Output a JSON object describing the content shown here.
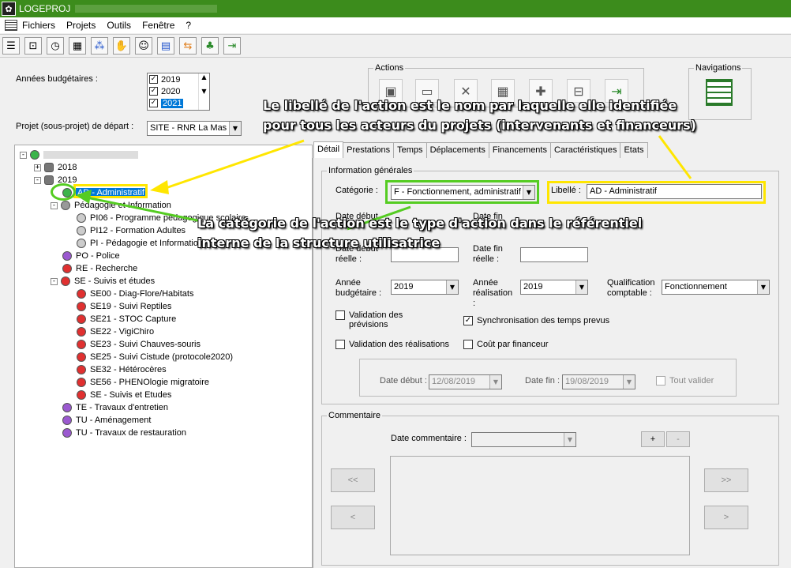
{
  "window": {
    "title": "LOGEPROJ"
  },
  "menu": [
    "Fichiers",
    "Projets",
    "Outils",
    "Fenêtre",
    "?"
  ],
  "toolbar_icons": [
    "list-icon",
    "tag-icon",
    "clock-icon",
    "calculator-icon",
    "network-icon",
    "handshake-icon",
    "people-icon",
    "chart-icon",
    "transfer-icon",
    "frog-icon",
    "exit-icon"
  ],
  "left": {
    "years_label": "Années budgétaires :",
    "years": [
      {
        "label": "2019",
        "checked": true,
        "selected": false
      },
      {
        "label": "2020",
        "checked": true,
        "selected": false
      },
      {
        "label": "2021",
        "checked": true,
        "selected": true
      }
    ],
    "project_label": "Projet (sous-projet) de départ :",
    "project_value": "SITE - RNR La Mas",
    "tree": {
      "y2018": "2018",
      "y2019": "2019",
      "items": [
        {
          "label": "AD - Administratif",
          "color": "#3cb44b",
          "indent": 0,
          "selected": true
        },
        {
          "label": "Pédagogie et Information",
          "color": "#999999",
          "indent": 0,
          "expander": "-"
        },
        {
          "label": "PI06 - Programme pédagogique scolaire",
          "color": "#cccccc",
          "indent": 1
        },
        {
          "label": "PI12 - Formation Adultes",
          "color": "#cccccc",
          "indent": 1
        },
        {
          "label": "PI - Pédagogie et Information",
          "color": "#cccccc",
          "indent": 1
        },
        {
          "label": "PO - Police",
          "color": "#9b59d0",
          "indent": 0
        },
        {
          "label": "RE - Recherche",
          "color": "#e03030",
          "indent": 0
        },
        {
          "label": "SE - Suivis et études",
          "color": "#e03030",
          "indent": 0,
          "expander": "-"
        },
        {
          "label": "SE00 - Diag-Flore/Habitats",
          "color": "#e03030",
          "indent": 1
        },
        {
          "label": "SE19 - Suivi Reptiles",
          "color": "#e03030",
          "indent": 1
        },
        {
          "label": "SE21 - STOC Capture",
          "color": "#e03030",
          "indent": 1
        },
        {
          "label": "SE22 - VigiChiro",
          "color": "#e03030",
          "indent": 1
        },
        {
          "label": "SE23 - Suivi Chauves-souris",
          "color": "#e03030",
          "indent": 1
        },
        {
          "label": "SE25 - Suivi Cistude (protocole2020)",
          "color": "#e03030",
          "indent": 1
        },
        {
          "label": "SE32 - Hétérocères",
          "color": "#e03030",
          "indent": 1
        },
        {
          "label": "SE56 - PHENOlogie migratoire",
          "color": "#e03030",
          "indent": 1
        },
        {
          "label": "SE - Suivis et Etudes",
          "color": "#e03030",
          "indent": 1
        },
        {
          "label": "TE - Travaux d'entretien",
          "color": "#9b59d0",
          "indent": 0
        },
        {
          "label": "TU - Aménagement",
          "color": "#9b59d0",
          "indent": 0
        },
        {
          "label": "TU - Travaux de restauration",
          "color": "#9b59d0",
          "indent": 0
        }
      ]
    }
  },
  "actions": {
    "title": "Actions",
    "icons": [
      "new-action-icon",
      "save-icon",
      "delete-icon",
      "calendar-icon",
      "add-line-icon",
      "remove-line-icon",
      "exit-door-icon"
    ]
  },
  "navigations": {
    "title": "Navigations"
  },
  "tabs": [
    "Détail",
    "Prestations",
    "Temps",
    "Déplacements",
    "Financements",
    "Caractéristiques",
    "Etats"
  ],
  "detail": {
    "general_title": "Information générales",
    "categorie_label": "Catégorie :",
    "categorie_value": "F - Fonctionnement, administratif",
    "libelle_label": "Libellé :",
    "libelle_value": "AD - Administratif",
    "date_debut_prev_label": "Date début",
    "date_fin_prev_label": "Date fin",
    "date_debut_reelle_label": "Date début réelle :",
    "date_fin_reelle_label": "Date fin réelle :",
    "annee_budg_label": "Année budgétaire :",
    "annee_budg_value": "2019",
    "annee_real_label": "Année réalisation :",
    "annee_real_value": "2019",
    "qualif_label": "Qualification comptable :",
    "qualif_value": "Fonctionnement",
    "valid_prev_label": "Validation des prévisions",
    "sync_label": "Synchronisation des temps prevus",
    "valid_real_label": "Validation des réalisations",
    "cout_label": "Coût par financeur",
    "date_debut_label": "Date début :",
    "date_debut_value": "12/08/2019",
    "date_fin_label": "Date fin :",
    "date_fin_value": "19/08/2019",
    "tout_valider_label": "Tout valider"
  },
  "commentaire": {
    "title": "Commentaire",
    "date_label": "Date commentaire :",
    "plus": "+",
    "minus": "-",
    "first": "<<",
    "prev": "<",
    "last": ">>",
    "next": ">"
  },
  "annotations": {
    "libelle_line1": "Le libellé de l'action est le nom par laquelle elle identifiée",
    "libelle_line2": "pour tous les acteurs du projets (intervenants et financeurs)",
    "categorie_line1": "La catégorie de l'action est le type d'action dans le référentiel",
    "categorie_line2": "interne de la structure utilisatrice"
  }
}
